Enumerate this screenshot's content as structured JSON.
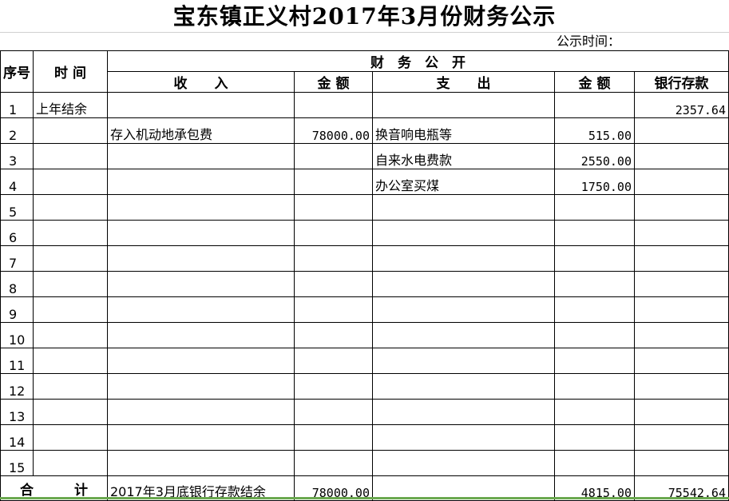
{
  "title": "宝东镇正义村2017年3月份财务公示",
  "publish_time_label": "公示时间：",
  "headers": {
    "seq": "序号",
    "time": "时 间",
    "group": "财　务　公　开",
    "income": "收　　入",
    "income_amount": "金 额",
    "expense": "支　　出",
    "expense_amount": "金 额",
    "bank": "银行存款"
  },
  "rows": [
    {
      "seq": "1",
      "time": "上年结余",
      "income": "",
      "income_amount": "",
      "expense": "",
      "expense_amount": "",
      "bank": "2357.64"
    },
    {
      "seq": "2",
      "time": "",
      "income": "存入机动地承包费",
      "income_amount": "78000.00",
      "expense": "换音响电瓶等",
      "expense_amount": "515.00",
      "bank": ""
    },
    {
      "seq": "3",
      "time": "",
      "income": "",
      "income_amount": "",
      "expense": "自来水电费款",
      "expense_amount": "2550.00",
      "bank": ""
    },
    {
      "seq": "4",
      "time": "",
      "income": "",
      "income_amount": "",
      "expense": "办公室买煤",
      "expense_amount": "1750.00",
      "bank": ""
    },
    {
      "seq": "5",
      "time": "",
      "income": "",
      "income_amount": "",
      "expense": "",
      "expense_amount": "",
      "bank": ""
    },
    {
      "seq": "6",
      "time": "",
      "income": "",
      "income_amount": "",
      "expense": "",
      "expense_amount": "",
      "bank": ""
    },
    {
      "seq": "7",
      "time": "",
      "income": "",
      "income_amount": "",
      "expense": "",
      "expense_amount": "",
      "bank": ""
    },
    {
      "seq": "8",
      "time": "",
      "income": "",
      "income_amount": "",
      "expense": "",
      "expense_amount": "",
      "bank": ""
    },
    {
      "seq": "9",
      "time": "",
      "income": "",
      "income_amount": "",
      "expense": "",
      "expense_amount": "",
      "bank": ""
    },
    {
      "seq": "10",
      "time": "",
      "income": "",
      "income_amount": "",
      "expense": "",
      "expense_amount": "",
      "bank": ""
    },
    {
      "seq": "11",
      "time": "",
      "income": "",
      "income_amount": "",
      "expense": "",
      "expense_amount": "",
      "bank": ""
    },
    {
      "seq": "12",
      "time": "",
      "income": "",
      "income_amount": "",
      "expense": "",
      "expense_amount": "",
      "bank": ""
    },
    {
      "seq": "13",
      "time": "",
      "income": "",
      "income_amount": "",
      "expense": "",
      "expense_amount": "",
      "bank": ""
    },
    {
      "seq": "14",
      "time": "",
      "income": "",
      "income_amount": "",
      "expense": "",
      "expense_amount": "",
      "bank": ""
    },
    {
      "seq": "15",
      "time": "",
      "income": "",
      "income_amount": "",
      "expense": "",
      "expense_amount": "",
      "bank": ""
    }
  ],
  "total": {
    "label": "合　　　计",
    "income": "2017年3月底银行存款结余",
    "income_amount": "78000.00",
    "expense": "",
    "expense_amount": "4815.00",
    "bank": "75542.64"
  }
}
